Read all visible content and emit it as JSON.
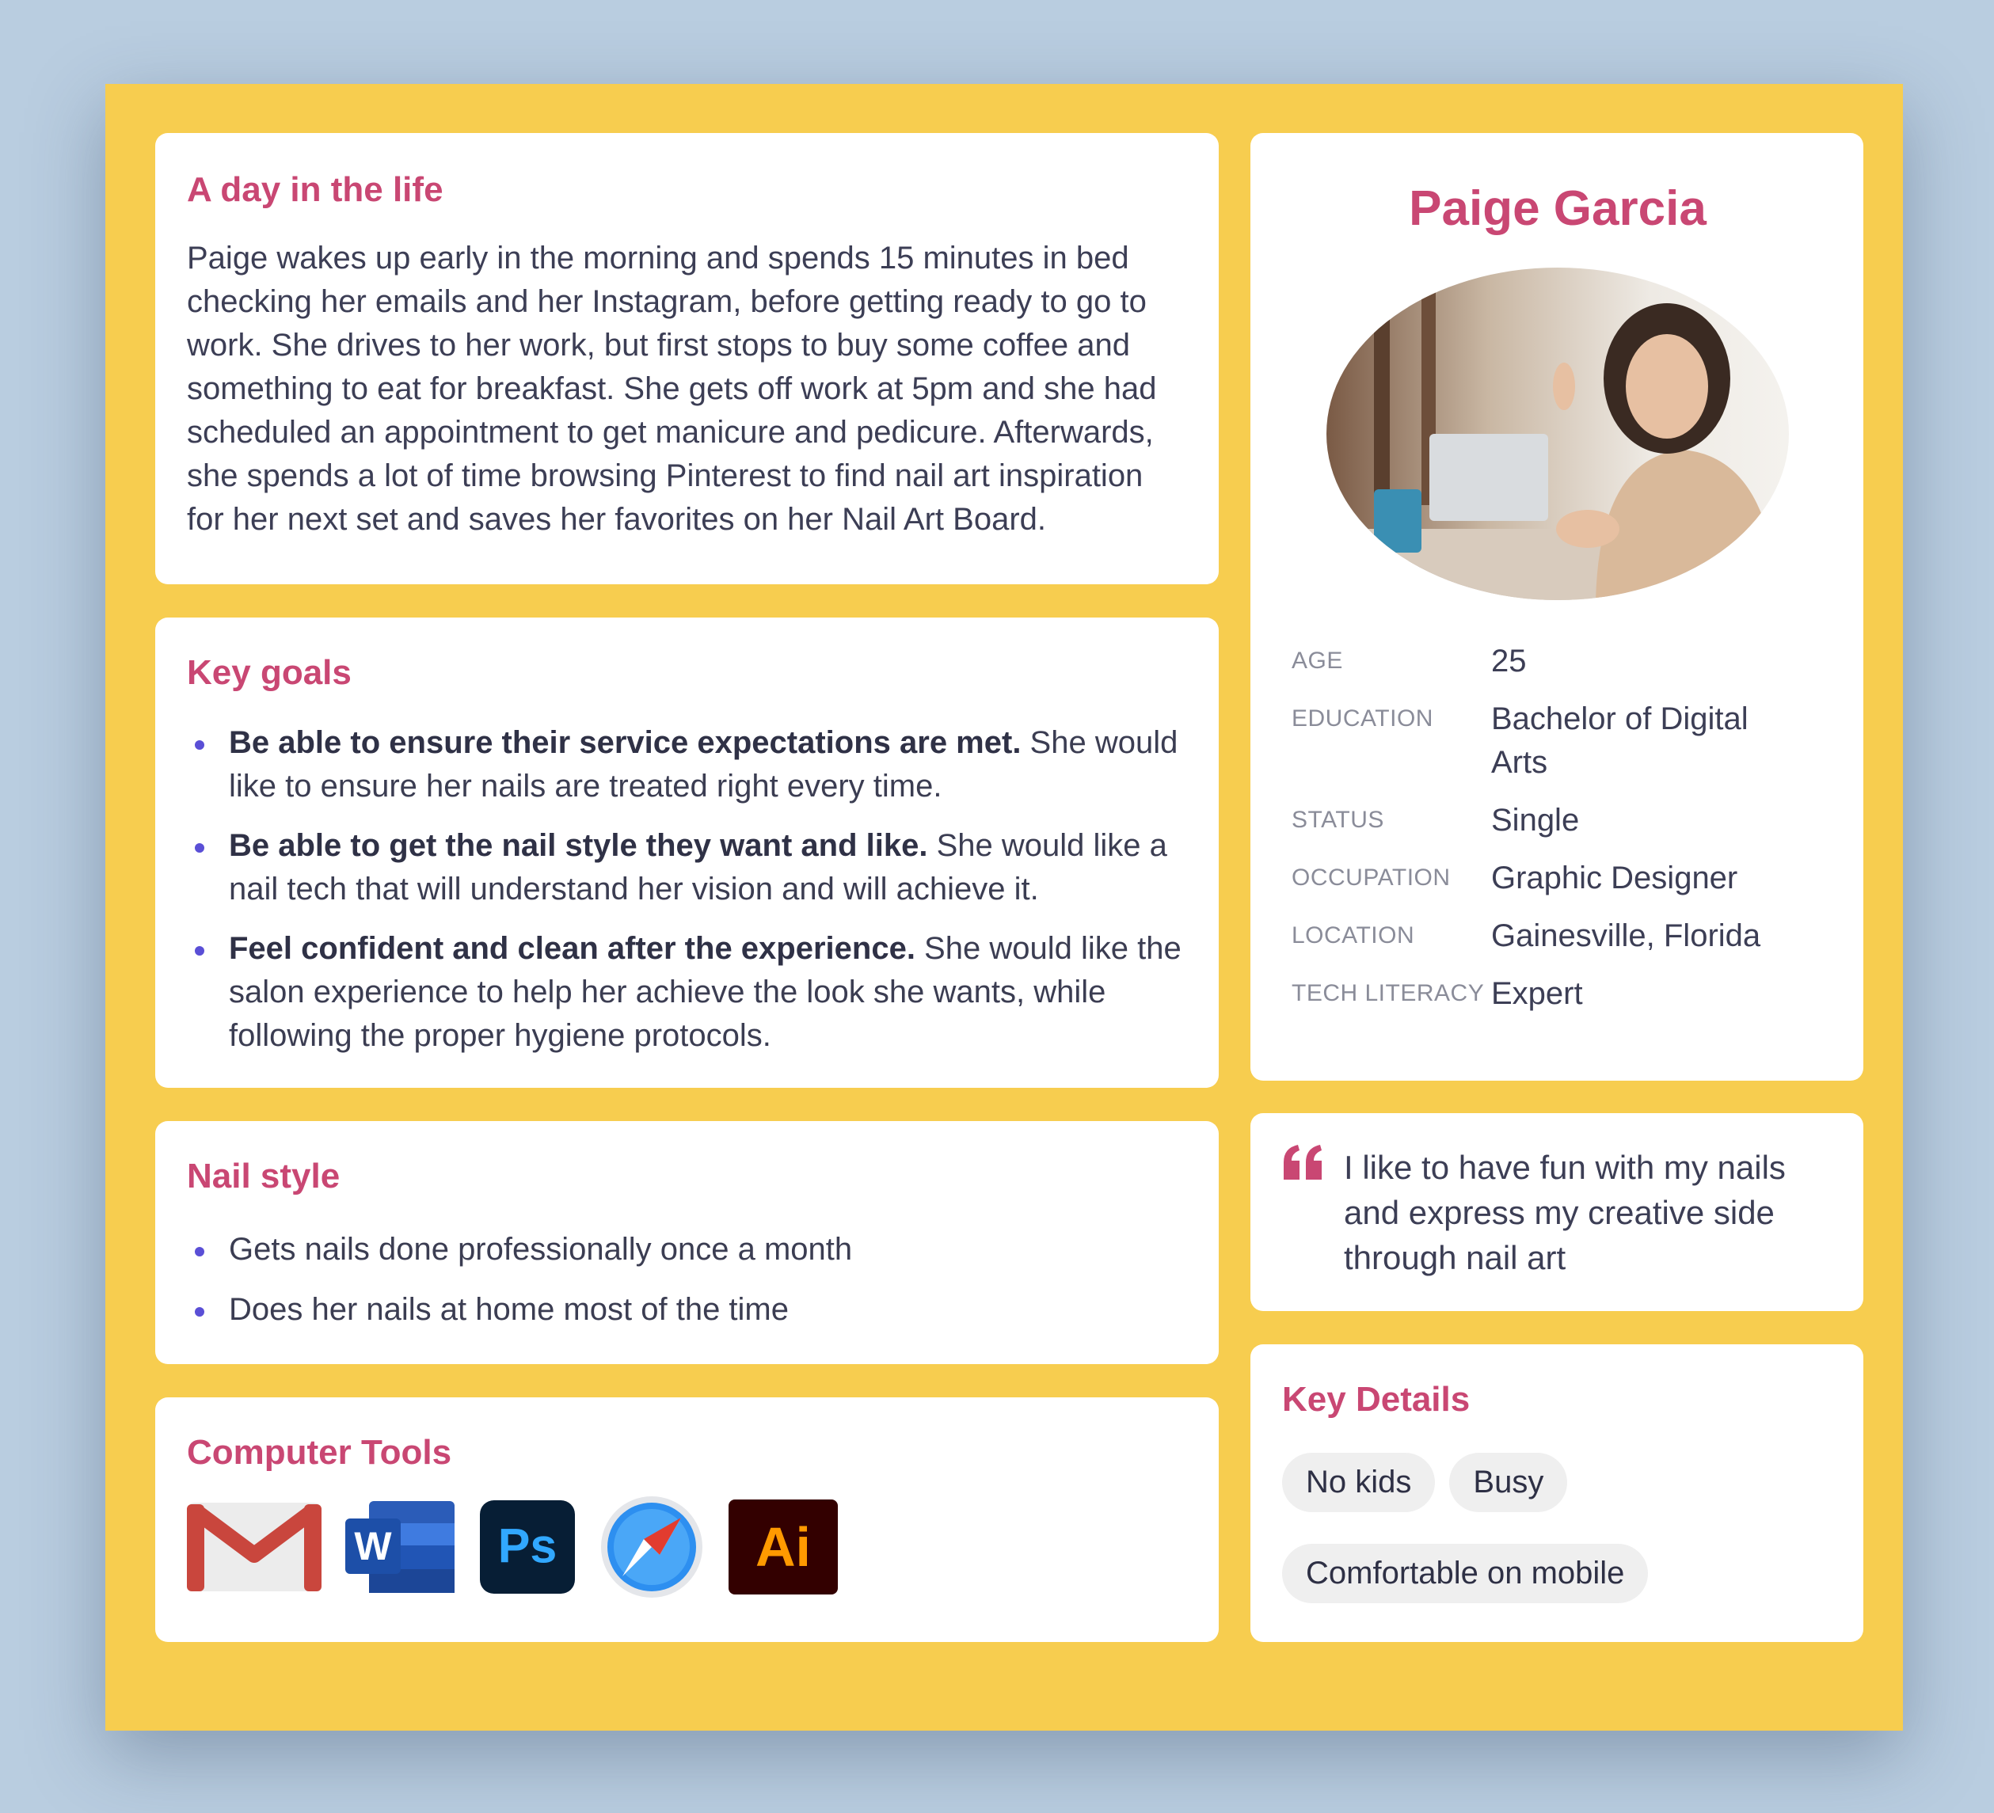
{
  "day": {
    "title": "A day in the life",
    "text": "Paige wakes up early in the morning and spends 15 minutes in bed checking her emails and her Instagram, before getting ready to go to work. She drives to her work, but first stops to buy some coffee and something to eat for breakfast. She gets off work at 5pm and she had scheduled an appointment to get manicure and pedicure. Afterwards, she spends a lot of time browsing Pinterest to find nail art inspiration for her next set and saves her favorites on her Nail Art Board."
  },
  "goals": {
    "title": "Key goals",
    "items": [
      {
        "bold": "Be able to ensure their service expectations are met.",
        "text": " She would like to ensure her nails are treated right every time."
      },
      {
        "bold": "Be able to get the nail style they want and like.",
        "text": " She would like a nail tech that will understand her vision and will achieve it."
      },
      {
        "bold": "Feel confident and clean after the experience.",
        "text": " She would like the salon experience to help her achieve the look she wants, while following the proper hygiene protocols."
      }
    ]
  },
  "nail_style": {
    "title": "Nail style",
    "items": [
      "Gets nails done professionally once a month",
      "Does her nails at home most of the time"
    ]
  },
  "tools": {
    "title": "Computer Tools",
    "icons": [
      "gmail-icon",
      "word-icon",
      "photoshop-icon",
      "safari-icon",
      "illustrator-icon"
    ],
    "word_letter": "W",
    "ps_letters": "Ps",
    "ai_letters": "Ai"
  },
  "profile": {
    "name": "Paige Garcia",
    "facts": [
      {
        "label": "AGE",
        "value": "25"
      },
      {
        "label": "EDUCATION",
        "value": "Bachelor of Digital Arts"
      },
      {
        "label": "STATUS",
        "value": "Single"
      },
      {
        "label": "OCCUPATION",
        "value": "Graphic Designer"
      },
      {
        "label": "LOCATION",
        "value": "Gainesville, Florida"
      },
      {
        "label": "TECH LITERACY",
        "value": "Expert"
      }
    ]
  },
  "quote": {
    "text": "I like to have fun with my nails and express my creative side through nail art"
  },
  "details": {
    "title": "Key Details",
    "chips": [
      "No kids",
      "Busy",
      "Comfortable on mobile"
    ]
  },
  "colors": {
    "board": "#f7cd4f",
    "accent": "#c94773",
    "bullet": "#5a4fd6",
    "background": "#b9cde0"
  }
}
